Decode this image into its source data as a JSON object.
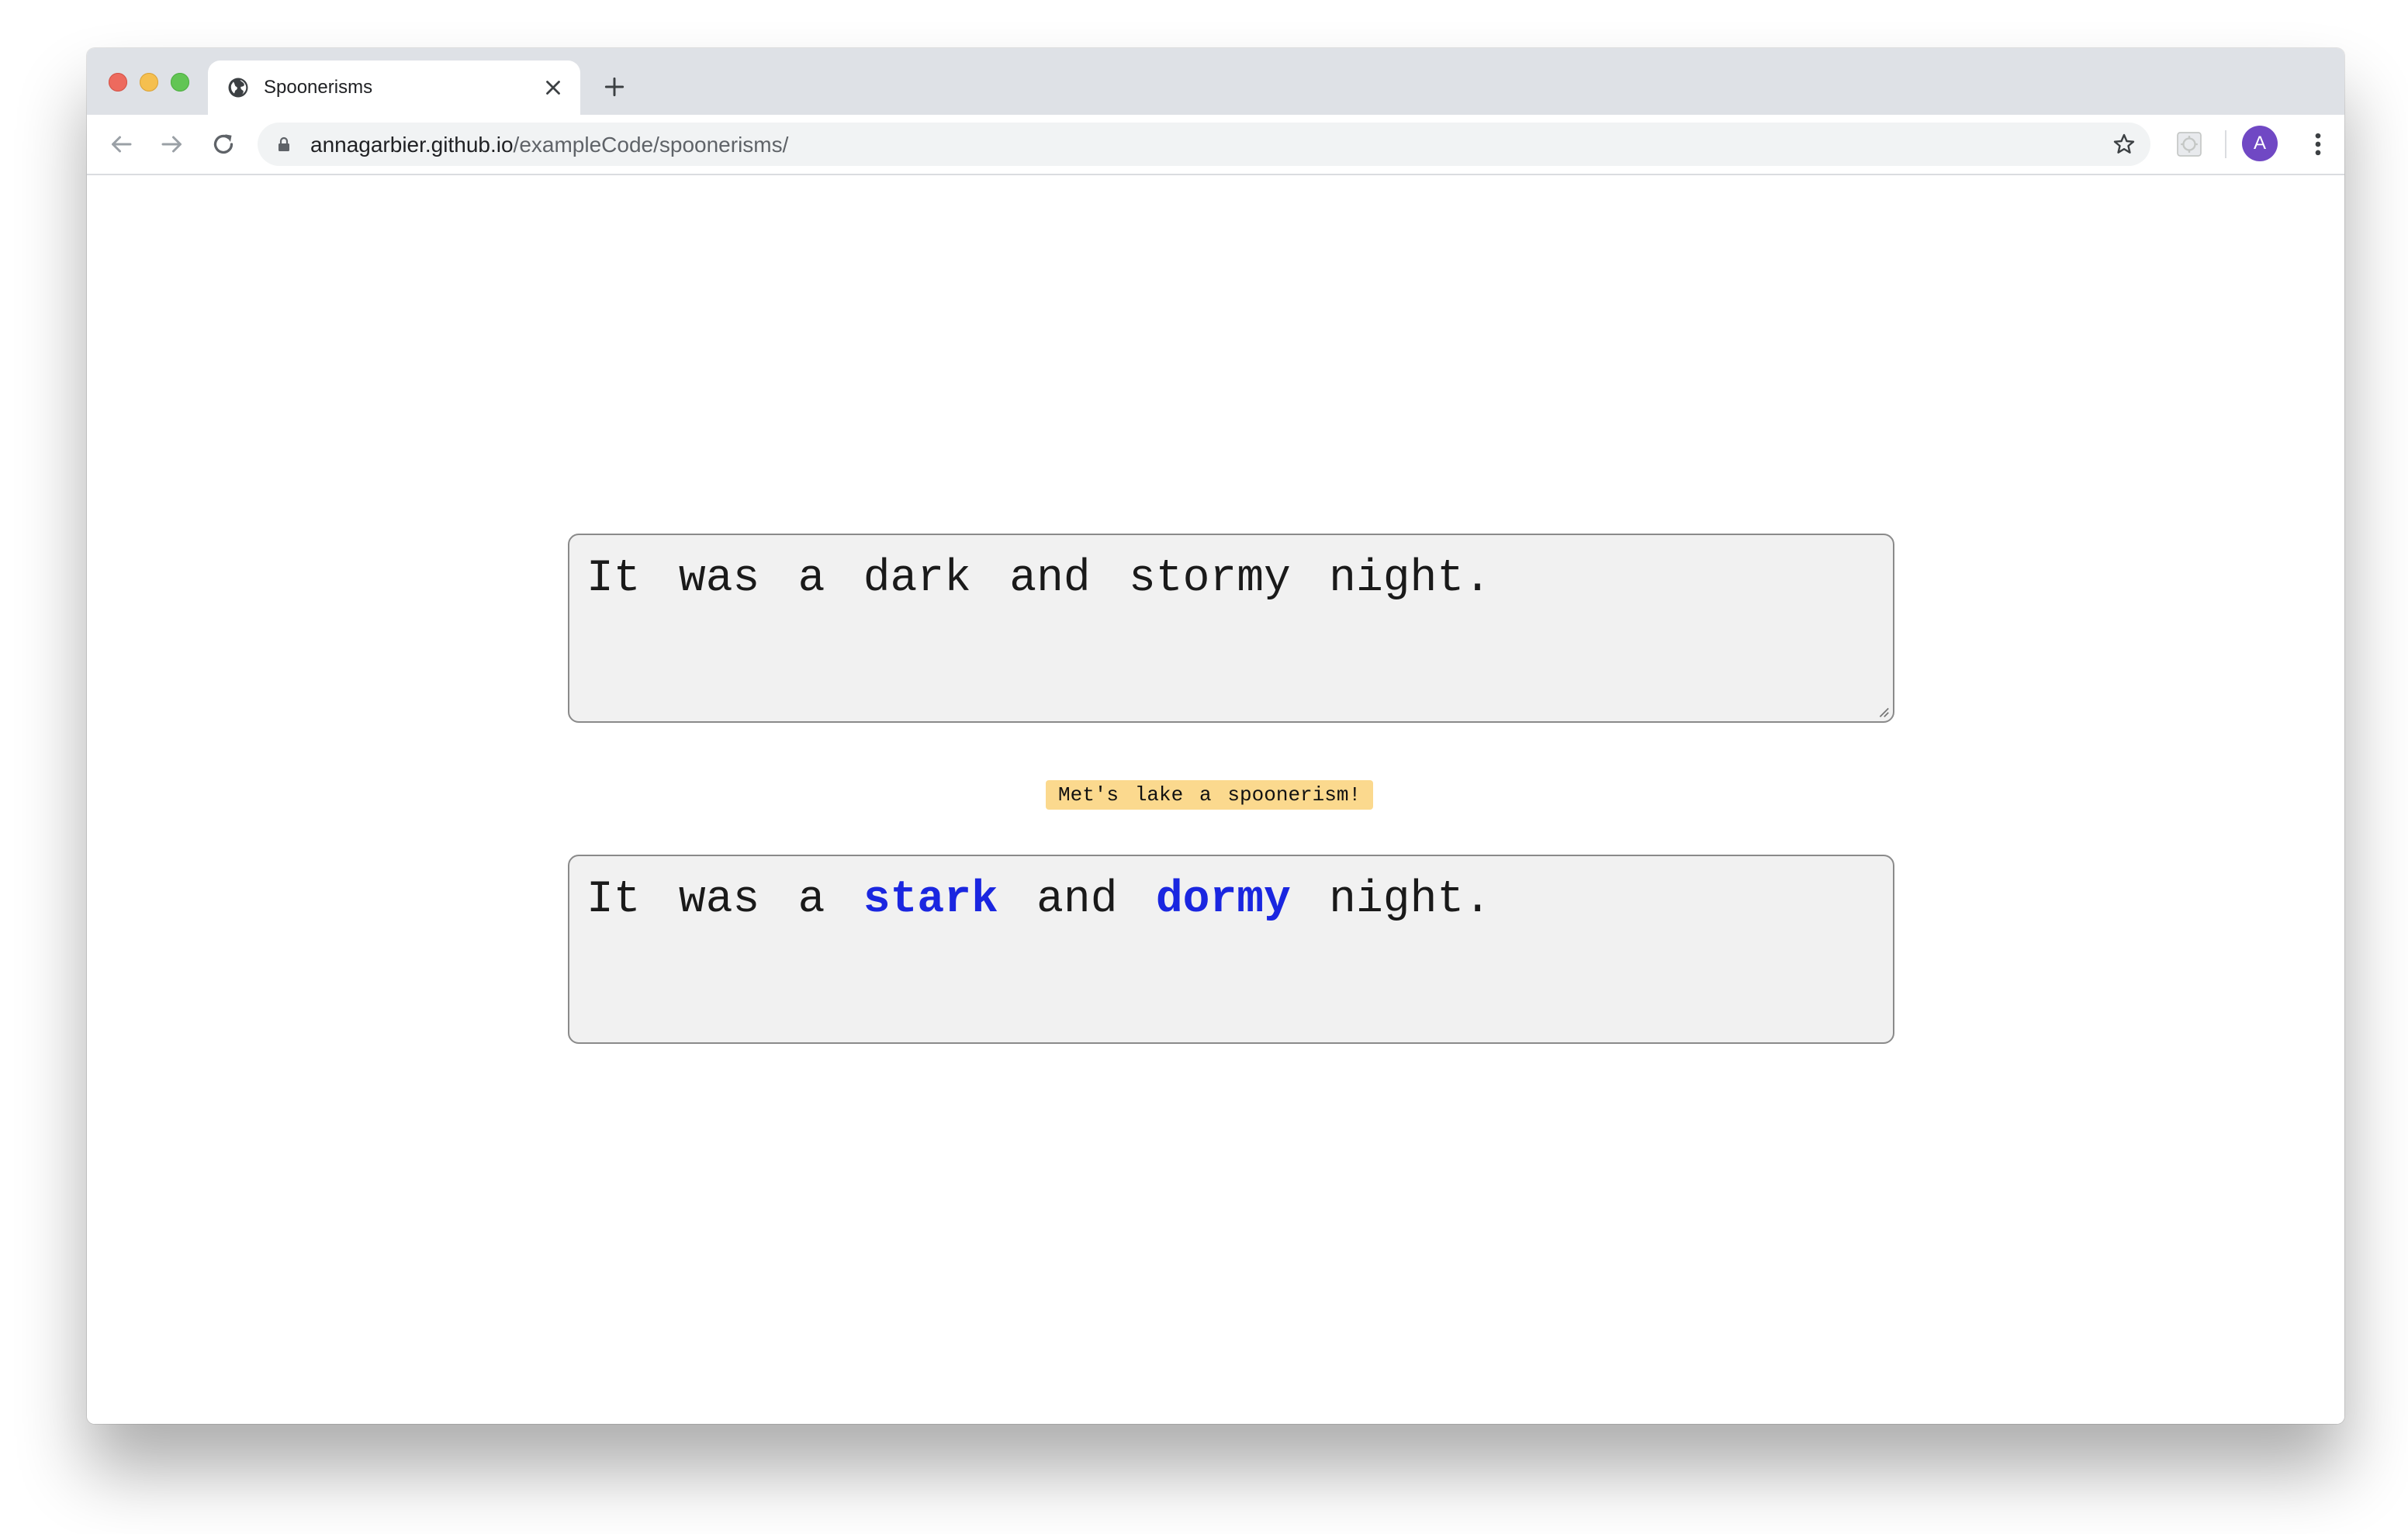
{
  "browser": {
    "tab": {
      "title": "Spoonerisms"
    },
    "address_bar": {
      "host": "annagarbier.github.io",
      "path": "/exampleCode/spoonerisms/"
    },
    "profile": {
      "initial": "A",
      "color": "#7048c4"
    }
  },
  "page": {
    "input_text": "It was a dark and stormy night.",
    "button_label": "Met's lake a spoonerism!",
    "output": {
      "segments": [
        {
          "text": "It was a ",
          "highlight": false
        },
        {
          "text": "stark",
          "highlight": true
        },
        {
          "text": " and ",
          "highlight": false
        },
        {
          "text": "dormy",
          "highlight": true
        },
        {
          "text": " night.",
          "highlight": false
        }
      ],
      "highlight_color": "#1a26e0"
    },
    "button_color": "#fbd98e",
    "textbox_background": "#f1f1f1"
  }
}
